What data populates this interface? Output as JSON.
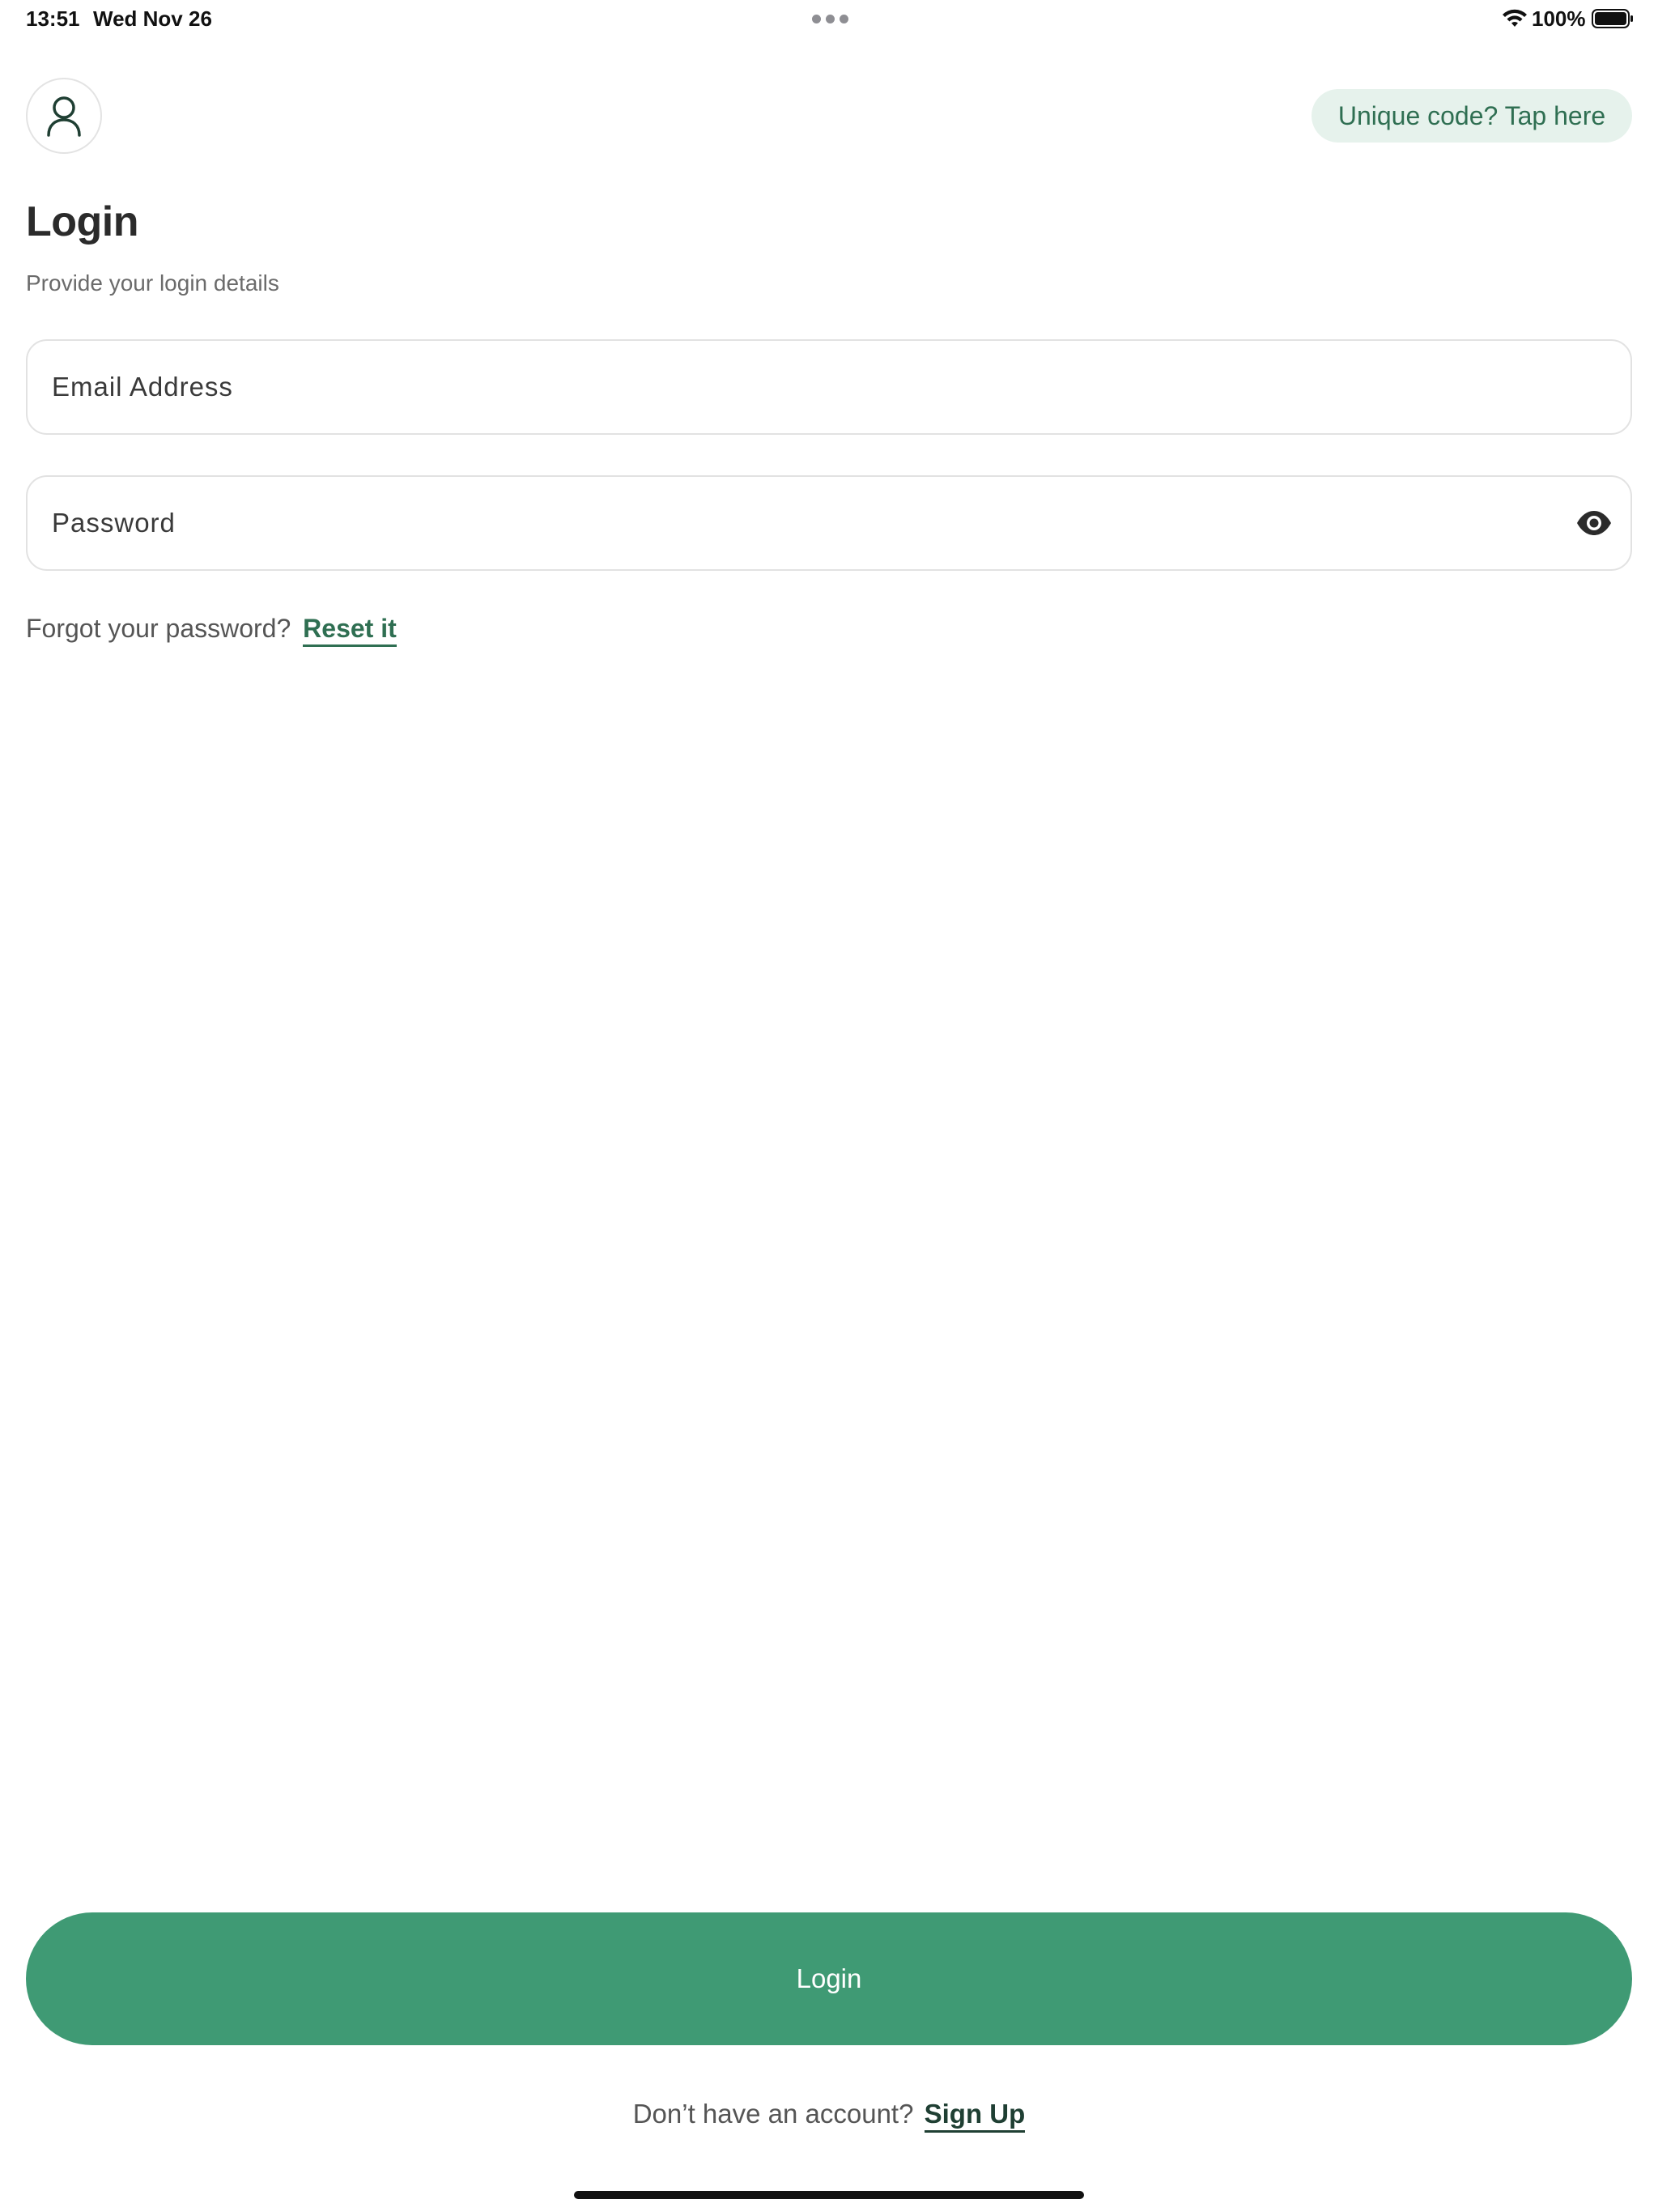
{
  "status_bar": {
    "time": "13:51",
    "date": "Wed Nov 26",
    "battery": "100%"
  },
  "header": {
    "unique_code_label": "Unique code? Tap here",
    "avatar_icon": "user-icon"
  },
  "page": {
    "title": "Login",
    "subtitle": "Provide your login details"
  },
  "form": {
    "email_placeholder": "Email Address",
    "email_value": "",
    "password_placeholder": "Password",
    "password_value": "",
    "password_toggle_icon": "eye-icon"
  },
  "forgot": {
    "prompt": "Forgot your password?",
    "link": "Reset it"
  },
  "actions": {
    "login_label": "Login"
  },
  "signup": {
    "prompt": "Don’t have an account?",
    "link": "Sign Up"
  },
  "colors": {
    "brand_green": "#3f9a74",
    "link_green": "#2f6f52",
    "chip_background": "#e6f2ec"
  }
}
